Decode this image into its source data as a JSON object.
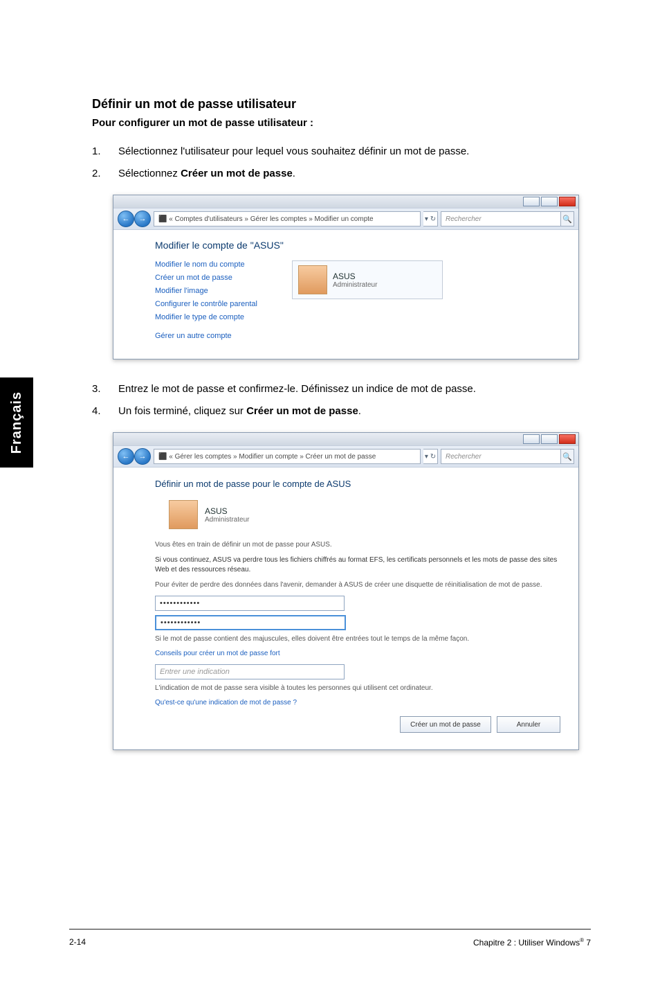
{
  "sideTab": "Français",
  "heading": "Définir un mot de passe utilisateur",
  "subheading": "Pour configurer un mot de passe utilisateur :",
  "steps": {
    "s1": {
      "n": "1.",
      "t": "Sélectionnez l'utilisateur pour lequel vous souhaitez définir un mot de passe."
    },
    "s2": {
      "n": "2.",
      "pre": "Sélectionnez ",
      "bold": "Créer un mot de passe",
      "post": "."
    },
    "s3": {
      "n": "3.",
      "t": "Entrez le mot de passe et confirmez-le. Définissez un indice de mot de passe."
    },
    "s4": {
      "n": "4.",
      "pre": "Un fois terminé, cliquez sur ",
      "bold": "Créer un mot de passe",
      "post": "."
    }
  },
  "win1": {
    "nav": {
      "back": "←",
      "fwd": "→",
      "refresh": "▾ ↻",
      "mag": "🔍",
      "breadcrumb": "⬛ « Comptes d'utilisateurs » Gérer les comptes » Modifier un compte",
      "searchPlaceholder": "Rechercher"
    },
    "title": "Modifier le compte de \"ASUS\"",
    "links": {
      "l1": "Modifier le nom du compte",
      "l2": "Créer un mot de passe",
      "l3": "Modifier l'image",
      "l4": "Configurer le contrôle parental",
      "l5": "Modifier le type de compte",
      "l6": "Gérer un autre compte"
    },
    "account": {
      "name": "ASUS",
      "role": "Administrateur"
    }
  },
  "win2": {
    "nav": {
      "back": "←",
      "fwd": "→",
      "refresh": "▾ ↻",
      "mag": "🔍",
      "breadcrumb": "⬛ « Gérer les comptes » Modifier un compte » Créer un mot de passe",
      "searchPlaceholder": "Rechercher"
    },
    "heading": "Définir un mot de passe pour le compte de ASUS",
    "account": {
      "name": "ASUS",
      "role": "Administrateur"
    },
    "para1": "Vous êtes en train de définir un mot de passe pour ASUS.",
    "para2": "Si vous continuez, ASUS va perdre tous les fichiers chiffrés au format EFS, les certificats personnels et les mots de passe des sites Web et des ressources réseau.",
    "para3": "Pour éviter de perdre des données dans l'avenir, demander à ASUS de créer une disquette de réinitialisation de mot de passe.",
    "pw1": "••••••••••••",
    "pw2": "••••••••••••",
    "hintInfo1": "Si le mot de passe contient des majuscules, elles doivent être entrées tout le temps de la même façon.",
    "hintLink1": "Conseils pour créer un mot de passe fort",
    "hintPlaceholder": "Entrer une indication",
    "hintInfo2": "L'indication de mot de passe sera visible à toutes les personnes qui utilisent cet ordinateur.",
    "hintLink2": "Qu'est-ce qu'une indication de mot de passe ?",
    "btnCreate": "Créer un mot de passe",
    "btnCancel": "Annuler"
  },
  "footer": {
    "left": "2-14",
    "right_a": "Chapitre 2 : Utiliser Windows",
    "right_sup": "®",
    "right_b": " 7"
  }
}
